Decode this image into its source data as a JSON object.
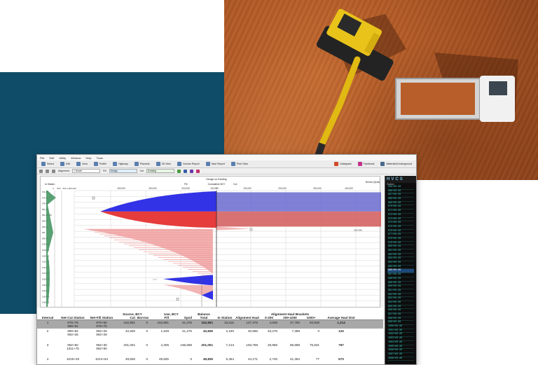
{
  "menu": [
    "File",
    "Edit",
    "Utility",
    "Window",
    "Help",
    "Tools"
  ],
  "toolbar": {
    "left": [
      {
        "label": "Select",
        "icon": "select-icon"
      },
      {
        "label": "Edit",
        "icon": "edit-icon"
      },
      {
        "label": "Area",
        "icon": "area-icon"
      },
      {
        "label": "Profile",
        "icon": "profile-icon"
      },
      {
        "label": "Highway",
        "icon": "highway-icon"
      },
      {
        "label": "Plansets",
        "icon": "plansets-icon"
      },
      {
        "label": "3D View",
        "icon": "3d-view-icon"
      },
      {
        "label": "Volume Report",
        "icon": "volume-report-icon"
      },
      {
        "label": "Haul Report",
        "icon": "haul-report-icon"
      },
      {
        "label": "Print View",
        "icon": "print-view-icon"
      }
    ],
    "right": [
      {
        "label": "Dataspark",
        "icon": "dataspark-icon"
      },
      {
        "label": "Facebook",
        "icon": "facebook-icon"
      },
      {
        "label": "Materials/Underground",
        "icon": "materials-icon"
      }
    ]
  },
  "selectors": {
    "alignment_label": "Alignment",
    "alignment_value": "1 Model",
    "fill_label": "Fill",
    "fill_value": "Design",
    "cut_label": "Cut",
    "cut_value": "Existing"
  },
  "chart_header": {
    "top_title": "Design vs Existing",
    "left_label": "to Station",
    "mid_left": "Fill",
    "mid": "Cumulative BCY",
    "mid_right": "Cut",
    "right_label": "Borrow (Spoil)"
  },
  "chart_data": {
    "type": "area",
    "title": "Design vs Existing",
    "xlabel": "Cumulative BCY",
    "x_ticks": [
      "400,000",
      "300,000",
      "200,000",
      "100,000",
      "0",
      "100,000",
      "200,000",
      "300,000",
      "400,000"
    ],
    "left_ticks": [
      "0",
      "800",
      "600",
      "1,000,000"
    ],
    "stations": [
      "972+50",
      "976+75",
      "979+50",
      "981+25",
      "982+50,000",
      "986+75",
      "989+50",
      "992",
      "995+50",
      "1001+25",
      "1003+75",
      "1006+50",
      "1010+50",
      "1012+75",
      "1015+50",
      "1018+25",
      "1020+50",
      "1023+75",
      "1026+50",
      "1028+25"
    ],
    "annotation": "(206,300)",
    "colors": {
      "cut": "#3232e6",
      "fill": "#e63c3c",
      "cut_light": "#b9b9f2",
      "fill_light": "#f2b3b3"
    }
  },
  "side_panel": {
    "title": "Station",
    "items": [
      "965+00.00",
      "966+00.00",
      "967+00.00",
      "968+00.00",
      "969+00.00",
      "970+00.00",
      "971+00.00",
      "972+00.00",
      "973+00.00",
      "974+00.00",
      "975+00.00",
      "976+00.00",
      "977+00.00",
      "978+00.00",
      "979+00.00",
      "980+00.00",
      "981+00.00",
      "982+00.00",
      "983+00.00",
      "984+00.00",
      "985+00.00",
      "986+00.00",
      "987+00.00",
      "988+00.00",
      "989+00.00",
      "990+00.00",
      "991+00.00",
      "992+00.00",
      "993+00.00",
      "994+00.00",
      "995+00.00",
      "996+00.00",
      "997+00.00",
      "998+00.00",
      "999+00.00",
      "1000+00.00",
      "1001+00.00",
      "1002+00.00",
      "1003+00.00",
      "1004+00.00",
      "1005+00.00",
      "1006+00.00",
      "1007+00.00",
      "1008+00.00"
    ],
    "selected_index": 21
  },
  "table": {
    "headers": {
      "interval": "Interval",
      "net_cut": "Net-Cut Station",
      "net_fill": "Net-Fill Station",
      "source": "Source, BCY",
      "cut": "Cut",
      "borrow": "Borrow",
      "fill": "Fill",
      "use": "Use, BCY",
      "spoil": "Spoil",
      "balance": "Balance",
      "total": "Total",
      "in_station": "In Station",
      "alignment_haul": "Alignment Haul",
      "brackets": "Alignment Haul Brackets",
      "b1": "0-200",
      "b2": "200-1000",
      "b3": "1000+",
      "avg": "Average Haul Dist"
    },
    "rows": [
      {
        "interval": "1",
        "net_cut": [
          "976+75",
          "989+64"
        ],
        "net_fill": [
          "970+50",
          "978+75"
        ],
        "cut": "162,891",
        "borrow": "0",
        "fill": "162,891",
        "spoil": "41,276",
        "total": "162,891",
        "in_station": "15,515",
        "alignment_haul": "147,376",
        "b1": "4,638",
        "b2": "47,790",
        "b3": "94,948",
        "avg": "1,214"
      },
      {
        "interval": "2",
        "net_cut": [
          "989+84",
          "992+25"
        ],
        "net_fill": [
          "992+25",
          "992+29"
        ],
        "cut": "42,826",
        "borrow": "0",
        "fill": "1,549",
        "spoil": "41,276",
        "total": "42,826",
        "in_station": "2,160",
        "alignment_haul": "40,666",
        "b1": "33,278",
        "b2": "7,388",
        "b3": "0",
        "avg": "124"
      },
      {
        "interval": "3",
        "net_cut": [
          "992+50",
          "1011+75"
        ],
        "net_fill": [
          "992+30",
          "992+50"
        ],
        "cut": "201,001",
        "borrow": "0",
        "fill": "4,305",
        "spoil": "196,696",
        "total": "201,001",
        "in_station": "7,213",
        "alignment_haul": "193,788",
        "b1": "28,959",
        "b2": "88,998",
        "b3": "75,831",
        "avg": "797"
      },
      {
        "interval": "4",
        "net_cut": [
          "1019+25",
          ""
        ],
        "net_fill": [
          "1014+64",
          ""
        ],
        "cut": "49,825",
        "borrow": "0",
        "fill": "49,825",
        "spoil": "0",
        "total": "49,825",
        "in_station": "5,454",
        "alignment_haul": "44,171",
        "b1": "2,740",
        "b2": "41,354",
        "b3": "77",
        "avg": "573"
      }
    ]
  }
}
